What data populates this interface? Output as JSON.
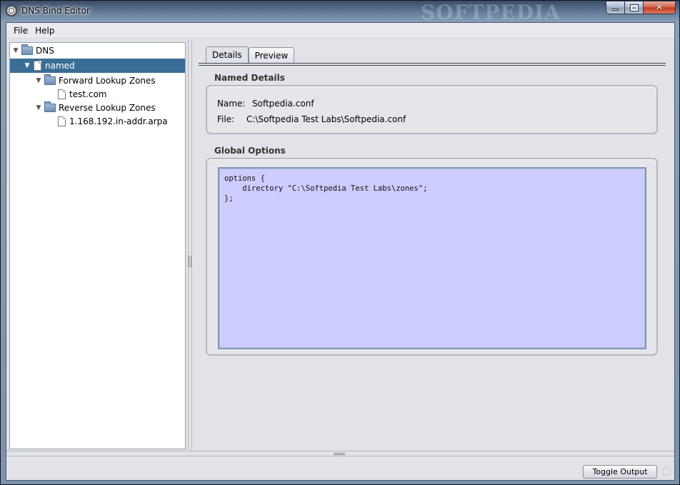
{
  "window": {
    "title": "DNS Bind Editor",
    "watermark": "SOFTPEDIA"
  },
  "menu": [
    "File",
    "Help"
  ],
  "tree": [
    {
      "label": "DNS",
      "icon": "folder-icon",
      "toggle": "▼",
      "selected": false
    },
    {
      "label": "named",
      "icon": "file-icon",
      "toggle": "▼",
      "selected": true
    },
    {
      "label": "Forward Lookup Zones",
      "icon": "folder-icon",
      "toggle": "▼",
      "selected": false
    },
    {
      "label": "test.com",
      "icon": "file-icon",
      "toggle": "",
      "selected": false
    },
    {
      "label": "Reverse Lookup Zones",
      "icon": "folder-icon",
      "toggle": "▼",
      "selected": false
    },
    {
      "label": "1.168.192.in-addr.arpa",
      "icon": "file-icon",
      "toggle": "",
      "selected": false
    }
  ],
  "tabs": [
    {
      "label": "Details",
      "active": true
    },
    {
      "label": "Preview",
      "active": false
    }
  ],
  "named_details": {
    "title": "Named Details",
    "name_label": "Name:",
    "name_value": "Softpedia.conf",
    "file_label": "File:",
    "file_value": "C:\\Softpedia Test Labs\\Softpedia.conf"
  },
  "global_options": {
    "title": "Global Options",
    "content": "options {\n    directory \"C:\\Softpedia Test Labs\\zones\";\n};"
  },
  "footer": {
    "toggle_output_label": "Toggle Output"
  }
}
